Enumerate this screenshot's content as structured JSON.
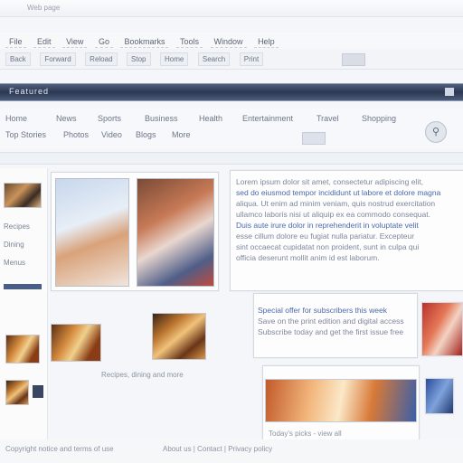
{
  "window": {
    "title": "Web page"
  },
  "menu": {
    "items": [
      "File",
      "Edit",
      "View",
      "Go",
      "Bookmarks",
      "Tools",
      "Window",
      "Help"
    ]
  },
  "toolbar": {
    "buttons": [
      "Back",
      "Forward",
      "Reload",
      "Stop",
      "Home",
      "Search",
      "Print"
    ]
  },
  "banner": {
    "text": "Featured"
  },
  "nav": {
    "links": [
      "Home",
      "News",
      "Sports",
      "Business",
      "Health",
      "Entertainment",
      "Travel",
      "Shopping"
    ],
    "sublinks": [
      "Top Stories",
      "Photos",
      "Video",
      "Blogs",
      "More"
    ]
  },
  "sidebar": {
    "links": [
      "Recipes",
      "Dining",
      "Menus"
    ]
  },
  "article": {
    "lines": [
      "Lorem ipsum dolor sit amet, consectetur adipiscing elit,",
      "sed do eiusmod tempor incididunt ut labore et dolore magna",
      "aliqua. Ut enim ad minim veniam, quis nostrud exercitation",
      "ullamco laboris nisi ut aliquip ex ea commodo consequat.",
      "Duis aute irure dolor in reprehenderit in voluptate velit",
      "esse cillum dolore eu fugiat nulla pariatur. Excepteur",
      "sint occaecat cupidatat non proident, sunt in culpa qui",
      "officia deserunt mollit anim id est laborum."
    ]
  },
  "promo": {
    "lines": [
      "Special offer for subscribers this week",
      "Save on the print edition and digital access",
      "Subscribe today and get the first issue free"
    ]
  },
  "captions": {
    "food": "Recipes, dining and more",
    "bottom": "Today's picks - view all",
    "footer_left": "Copyright notice and terms of use",
    "footer_mid": "About us | Contact | Privacy policy"
  }
}
